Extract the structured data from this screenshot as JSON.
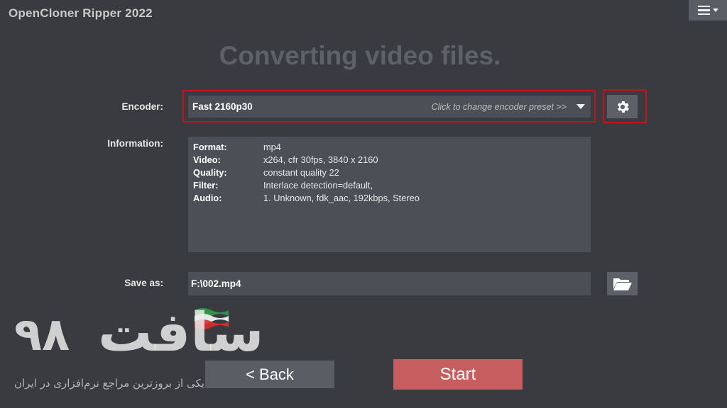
{
  "app": {
    "title": "OpenCloner Ripper 2022",
    "menu_icon": "hamburger-menu-icon"
  },
  "page": {
    "heading": "Converting video files."
  },
  "encoder": {
    "label": "Encoder:",
    "value": "Fast 2160p30",
    "hint": "Click to change encoder preset >>",
    "settings_icon": "gear-icon"
  },
  "information": {
    "label": "Information:",
    "rows": [
      {
        "key": "Format:",
        "value": "mp4"
      },
      {
        "key": "Video:",
        "value": "x264, cfr 30fps, 3840 x 2160"
      },
      {
        "key": "Quality:",
        "value": "constant quality 22"
      },
      {
        "key": "Filter:",
        "value": "Interlace detection=default,"
      },
      {
        "key": "Audio:",
        "value": "1. Unknown, fdk_aac, 192kbps, Stereo"
      }
    ]
  },
  "save": {
    "label": "Save as:",
    "value": "F:\\002.mp4",
    "folder_icon": "folder-open-icon"
  },
  "actions": {
    "back_label": "<  Back",
    "start_label": "Start"
  },
  "watermark": {
    "number": "۹۸",
    "brand": "سافت",
    "tagline": "یکی از بروزترین مراجع نرم‌افزاری در ایران"
  },
  "colors": {
    "background": "#393b40",
    "field": "#4c4f55",
    "highlight_border": "#c1151d",
    "start_button": "#c65e5f"
  }
}
